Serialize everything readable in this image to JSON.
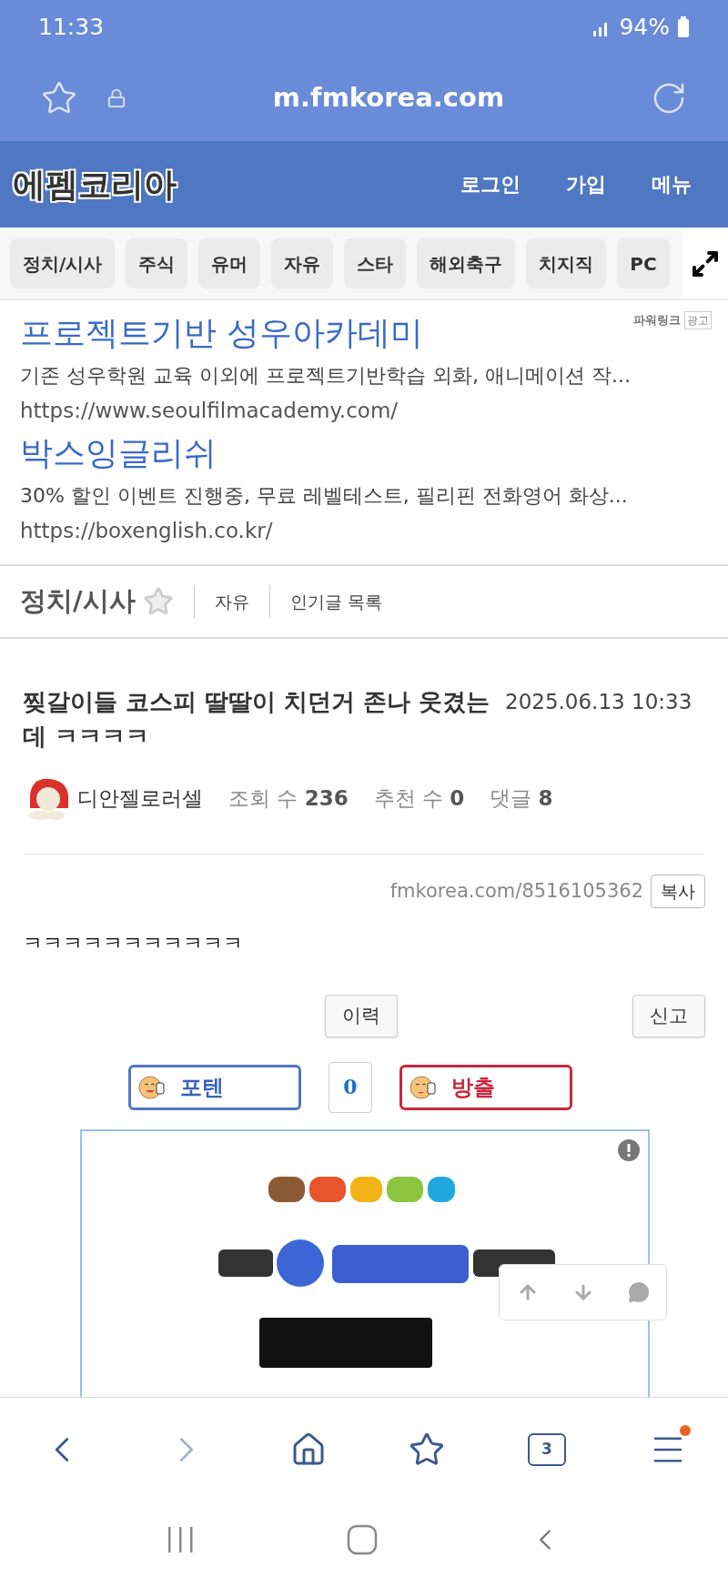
{
  "status_bar": {
    "time": "11:33",
    "battery": "94%"
  },
  "browser": {
    "url": "m.fmkorea.com"
  },
  "site_header": {
    "logo": "에펨코리아",
    "links": [
      "로그인",
      "가입",
      "메뉴"
    ]
  },
  "categories": [
    {
      "label": "정치/시사",
      "selected": false
    },
    {
      "label": "주식",
      "selected": false
    },
    {
      "label": "유머",
      "selected": false
    },
    {
      "label": "자유",
      "selected": false
    },
    {
      "label": "스타",
      "selected": false
    },
    {
      "label": "해외축구",
      "selected": false
    },
    {
      "label": "치지직",
      "selected": false
    },
    {
      "label": "PC",
      "selected": false
    }
  ],
  "power_links": {
    "label": "파워링크",
    "badge": "광고",
    "ads": [
      {
        "title": "프로젝트기반 성우아카데미",
        "description": "기존 성우학원 교육 이외에 프로젝트기반학습 외화, 애니메이션 작...",
        "url": "https://www.seoulfilmacademy.com/"
      },
      {
        "title": "박스잉글리쉬",
        "description": "30% 할인 이벤트 진행중, 무료 레벨테스트, 필리핀 전화영어 화상...",
        "url": "https://boxenglish.co.kr/"
      }
    ]
  },
  "board": {
    "title": "정치/시사",
    "links": [
      "자유",
      "인기글 목록"
    ]
  },
  "post": {
    "title": "찢갈이들 코스피 딸딸이 치던거 존나 웃겼는데 ㅋㅋㅋㅋ",
    "date": "2025.06.13 10:33",
    "author": "디안젤로러셀",
    "stats": [
      {
        "label": "조회 수",
        "value": "236"
      },
      {
        "label": "추천 수",
        "value": "0"
      },
      {
        "label": "댓글",
        "value": "8"
      }
    ],
    "link": "fmkorea.com/8516105362",
    "copy_button": "복사",
    "body": "ㅋㅋㅋㅋㅋㅋㅋㅋㅋㅋㅋ",
    "history_button": "이력",
    "report_button": "신고",
    "vote": {
      "up": "포텐",
      "count": "0",
      "down": "방출"
    }
  },
  "tab_count": "3"
}
